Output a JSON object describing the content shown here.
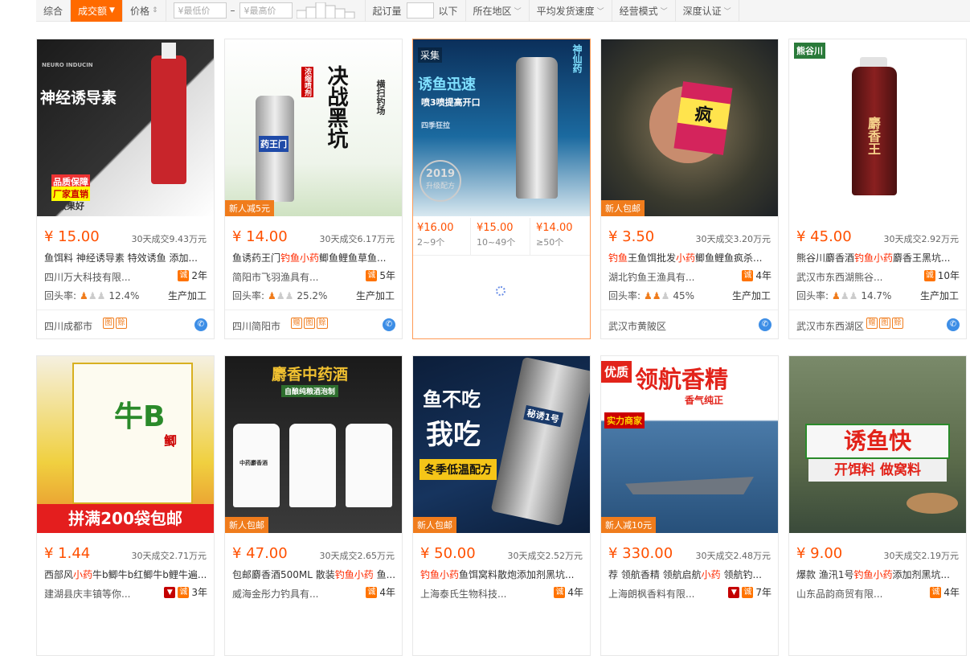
{
  "filter_bar": {
    "sort_comprehensive": "综合",
    "sort_volume": "成交额",
    "sort_price": "价格",
    "price_min_placeholder": "¥最低价",
    "price_dash": "–",
    "price_max_placeholder": "¥最高价",
    "moq_label": "起订量",
    "moq_below": "以下",
    "region": "所在地区",
    "ship_speed": "平均发货速度",
    "biz_mode": "经营模式",
    "depth_cert": "深度认证"
  },
  "products": [
    {
      "price": "¥ 15.00",
      "deals": "30天成交9.43万元",
      "title_parts": [
        {
          "t": "鱼饵料 神经诱导素 特效诱鱼 添加...",
          "kw": false
        }
      ],
      "company": "四川万大科技有限...",
      "years": "2年",
      "repeat_label": "回头率:",
      "repeat": "12.4%",
      "mode": "生产加工",
      "location": "四川成都市",
      "badge": "",
      "image_text": [
        "神经诱导素",
        "NEURO INDUCIN",
        "品质保障",
        "厂家直销",
        "效果好"
      ],
      "tag_icons": [
        "图",
        "赊"
      ],
      "shield": false
    },
    {
      "price": "¥ 14.00",
      "deals": "30天成交6.17万元",
      "title_parts": [
        {
          "t": "鱼诱药王门",
          "kw": false
        },
        {
          "t": "钓鱼小药",
          "kw": true
        },
        {
          "t": "鲫鱼鲤鱼草鱼...",
          "kw": false
        }
      ],
      "company": "简阳市飞羽渔具有...",
      "years": "5年",
      "repeat_label": "回头率:",
      "repeat": "25.2%",
      "mode": "生产加工",
      "location": "四川简阳市",
      "badge": "新人减5元",
      "image_text": [
        "决战黑坑",
        "药王门",
        "浓缩喷剂",
        "横扫钓场"
      ],
      "tag_icons": [
        "赠",
        "图",
        "赊"
      ],
      "shield": false
    },
    {
      "collect": "采集",
      "tiers": [
        {
          "price": "¥16.00",
          "qty": "2~9个"
        },
        {
          "price": "¥15.00",
          "qty": "10~49个"
        },
        {
          "price": "¥14.00",
          "qty": "≥50个"
        }
      ],
      "badge": "",
      "image_text": [
        "诱鱼迅速",
        "喷3喷提高开口",
        "2019",
        "升级配方",
        "神仙药",
        "四季狂拉"
      ]
    },
    {
      "price": "¥ 3.50",
      "deals": "30天成交3.20万元",
      "title_parts": [
        {
          "t": "钓鱼",
          "kw": true
        },
        {
          "t": "王鱼饵批发",
          "kw": false
        },
        {
          "t": "小药",
          "kw": true
        },
        {
          "t": "鲫鱼鲤鱼疯杀...",
          "kw": false
        }
      ],
      "company": "湖北钓鱼王渔具有...",
      "years": "4年",
      "repeat_label": "回头率:",
      "repeat": "45%",
      "mode": "生产加工",
      "location": "武汉市黄陂区",
      "badge": "新人包邮",
      "image_text": [
        "疯"
      ],
      "tag_icons": [],
      "shield": false
    },
    {
      "price": "¥ 45.00",
      "deals": "30天成交2.92万元",
      "title_parts": [
        {
          "t": "熊谷川麝香酒",
          "kw": false
        },
        {
          "t": "钓鱼小药",
          "kw": true
        },
        {
          "t": "麝香王黑坑...",
          "kw": false
        }
      ],
      "company": "武汉市东西湖熊谷...",
      "years": "10年",
      "repeat_label": "回头率:",
      "repeat": "14.7%",
      "mode": "生产加工",
      "location": "武汉市东西湖区",
      "badge": "",
      "image_text": [
        "熊谷川",
        "麝香王"
      ],
      "tag_icons": [
        "赠",
        "图",
        "赊"
      ],
      "shield": false
    },
    {
      "price": "¥ 1.44",
      "deals": "30天成交2.71万元",
      "title_parts": [
        {
          "t": "西部风",
          "kw": false
        },
        {
          "t": "小药",
          "kw": true
        },
        {
          "t": "牛b鲫牛b红鲫牛b鲤牛遍...",
          "kw": false
        }
      ],
      "company": "建湖县庆丰镇等你...",
      "years": "3年",
      "badge": "",
      "image_text": [
        "拼满200袋包邮",
        "牛B",
        "鲫"
      ],
      "shield": true
    },
    {
      "price": "¥ 47.00",
      "deals": "30天成交2.65万元",
      "title_parts": [
        {
          "t": "包邮麝香酒500ML 散装",
          "kw": false
        },
        {
          "t": "钓鱼小药",
          "kw": true
        },
        {
          "t": " 鱼...",
          "kw": false
        }
      ],
      "company": "威海金彤力钓具有...",
      "years": "4年",
      "badge": "新人包邮",
      "image_text": [
        "麝香中药酒",
        "自酿纯粮酒泡制",
        "中药麝香酒"
      ],
      "shield": false
    },
    {
      "price": "¥ 50.00",
      "deals": "30天成交2.52万元",
      "title_parts": [
        {
          "t": "钓鱼小药",
          "kw": true
        },
        {
          "t": "鱼饵窝料散炮添加剂黑坑...",
          "kw": false
        }
      ],
      "company": "上海泰氏生物科技...",
      "years": "4年",
      "badge": "新人包邮",
      "image_text": [
        "鱼不吃",
        "我吃",
        "冬季低温配方",
        "秘诱1号"
      ],
      "shield": false
    },
    {
      "price": "¥ 330.00",
      "deals": "30天成交2.48万元",
      "title_parts": [
        {
          "t": "荐 领航香精 领航启航",
          "kw": false
        },
        {
          "t": "小药",
          "kw": true
        },
        {
          "t": " 领航钓...",
          "kw": false
        }
      ],
      "company": "上海朗枫香料有限...",
      "years": "7年",
      "badge": "新人减10元",
      "image_text": [
        "优质",
        "领航香精",
        "香气纯正",
        "实力商家"
      ],
      "shield": true
    },
    {
      "price": "¥ 9.00",
      "deals": "30天成交2.19万元",
      "title_parts": [
        {
          "t": "爆款 渔汛1号",
          "kw": false
        },
        {
          "t": "钓鱼小药",
          "kw": true
        },
        {
          "t": "添加剂黑坑...",
          "kw": false
        }
      ],
      "company": "山东品韵商贸有限...",
      "years": "4年",
      "badge": "",
      "image_text": [
        "诱鱼快",
        "开饵料 做窝料"
      ],
      "shield": false
    }
  ]
}
